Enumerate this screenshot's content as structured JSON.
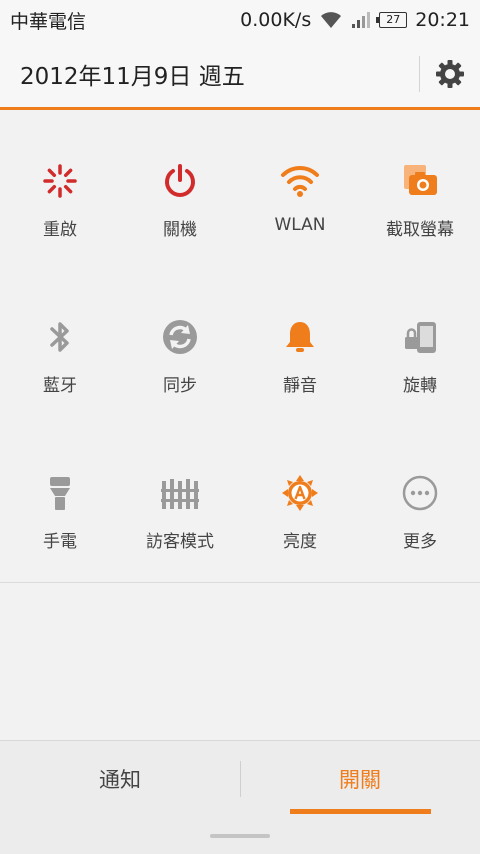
{
  "status_bar": {
    "carrier": "中華電信",
    "network_speed": "0.00K/s",
    "battery_level": "27",
    "time": "20:21"
  },
  "header": {
    "date": "2012年11月9日 週五",
    "settings_icon": "gear-icon"
  },
  "toggles": [
    {
      "label": "重啟",
      "icon": "restart-icon",
      "color": "#d12b2b"
    },
    {
      "label": "關機",
      "icon": "power-icon",
      "color": "#d12b2b"
    },
    {
      "label": "WLAN",
      "icon": "wifi-icon",
      "color": "#f07d1c"
    },
    {
      "label": "截取螢幕",
      "icon": "screenshot-icon",
      "color": "#f07d1c"
    },
    {
      "label": "藍牙",
      "icon": "bluetooth-icon",
      "color": "#9a9a9a"
    },
    {
      "label": "同步",
      "icon": "sync-icon",
      "color": "#9a9a9a"
    },
    {
      "label": "靜音",
      "icon": "bell-icon",
      "color": "#f07d1c"
    },
    {
      "label": "旋轉",
      "icon": "rotation-lock-icon",
      "color": "#9a9a9a"
    },
    {
      "label": "手電",
      "icon": "flashlight-icon",
      "color": "#9a9a9a"
    },
    {
      "label": "訪客模式",
      "icon": "guest-mode-icon",
      "color": "#9a9a9a"
    },
    {
      "label": "亮度",
      "icon": "brightness-auto-icon",
      "color": "#f07d1c"
    },
    {
      "label": "更多",
      "icon": "more-icon",
      "color": "#9a9a9a"
    }
  ],
  "tabs": {
    "notifications": "通知",
    "toggles": "開關",
    "active": "toggles"
  },
  "colors": {
    "accent": "#f07d1c",
    "danger": "#d12b2b",
    "inactive": "#9a9a9a"
  }
}
